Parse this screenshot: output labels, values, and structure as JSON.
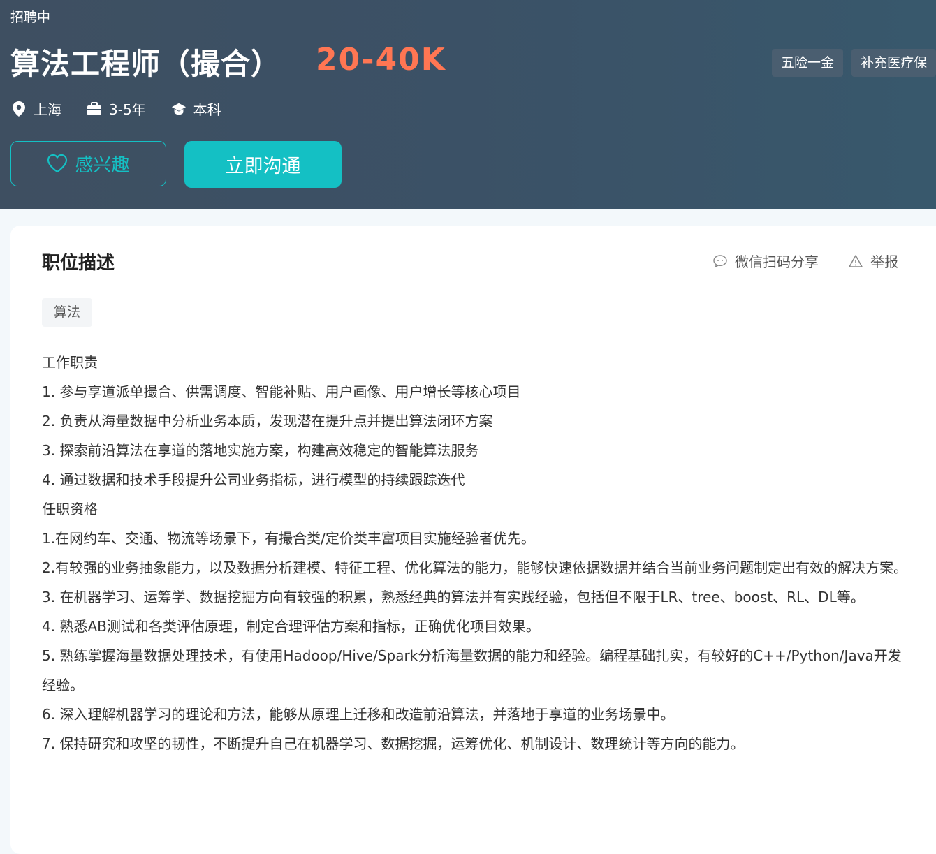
{
  "header": {
    "status": "招聘中",
    "title": "算法工程师（撮合）",
    "salary": "20-40K",
    "benefits": [
      "五险一金",
      "补充医疗保"
    ],
    "meta": {
      "location": "上海",
      "experience": "3-5年",
      "education": "本科"
    },
    "interest_label": "感兴趣",
    "chat_label": "立即沟通"
  },
  "card": {
    "title": "职位描述",
    "share_label": "微信扫码分享",
    "report_label": "举报",
    "skill_tag": "算法",
    "description": [
      "工作职责",
      "1. 参与享道派单撮合、供需调度、智能补贴、用户画像、用户增长等核心项目",
      "2. 负责从海量数据中分析业务本质，发现潜在提升点并提出算法闭环方案",
      "3. 探索前沿算法在享道的落地实施方案，构建高效稳定的智能算法服务",
      "4. 通过数据和技术手段提升公司业务指标，进行模型的持续跟踪迭代",
      "任职资格",
      "1.在网约车、交通、物流等场景下，有撮合类/定价类丰富项目实施经验者优先。",
      "2.有较强的业务抽象能力，以及数据分析建模、特征工程、优化算法的能力，能够快速依据数据并结合当前业务问题制定出有效的解决方案。",
      "3. 在机器学习、运筹学、数据挖掘方向有较强的积累，熟悉经典的算法并有实践经验，包括但不限于LR、tree、boost、RL、DL等。",
      "4. 熟悉AB测试和各类评估原理，制定合理评估方案和指标，正确优化项目效果。",
      "5. 熟练掌握海量数据处理技术，有使用Hadoop/Hive/Spark分析海量数据的能力和经验。编程基础扎实，有较好的C++/Python/Java开发经验。",
      "6. 深入理解机器学习的理论和方法，能够从原理上迁移和改造前沿算法，并落地于享道的业务场景中。",
      "7. 保持研究和攻坚的韧性，不断提升自己在机器学习、数据挖掘，运筹优化、机制设计、数理统计等方向的能力。"
    ]
  },
  "colors": {
    "header_bg": "#3b5166",
    "accent": "#14c0c4",
    "salary": "#ff7653"
  },
  "icons": [
    "location-icon",
    "briefcase-icon",
    "graduation-cap-icon",
    "heart-icon",
    "wechat-icon",
    "warning-icon"
  ]
}
